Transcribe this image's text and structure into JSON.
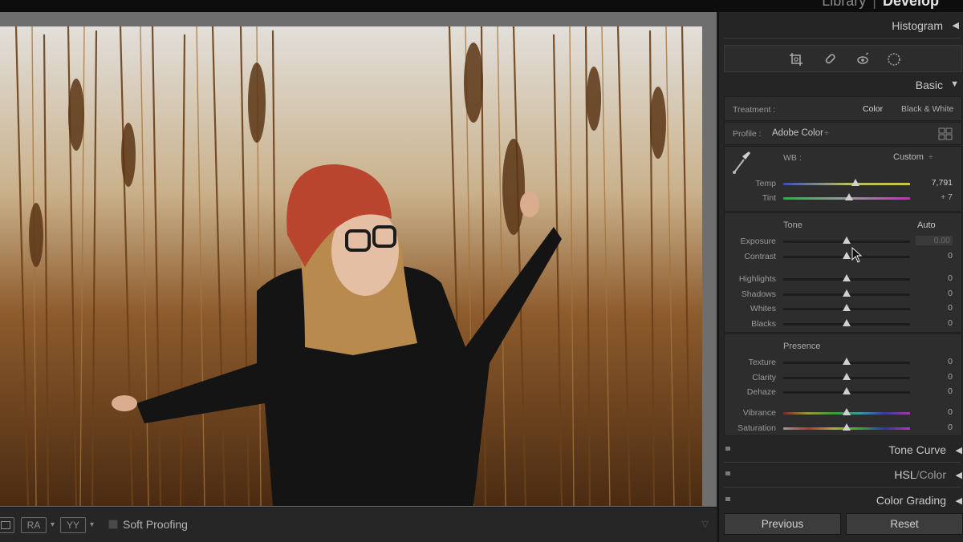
{
  "module_picker": {
    "library": "Library",
    "separator": "|",
    "develop": "Develop"
  },
  "panels": {
    "histogram": "Histogram",
    "basic": "Basic",
    "tone_curve": "Tone Curve",
    "hsl": "HSL",
    "hsl_sep": "/",
    "color": "Color",
    "color_grading": "Color Grading"
  },
  "tools": [
    "crop-overlay-icon",
    "healing-icon",
    "red-eye-icon",
    "masking-icon"
  ],
  "basic": {
    "treatment_label": "Treatment :",
    "treatment_color": "Color",
    "treatment_bw": "Black & White",
    "profile_label": "Profile :",
    "profile_value": "Adobe Color",
    "profile_stepper": "÷",
    "wb_label": "WB :",
    "wb_value": "Custom",
    "wb_stepper": "÷",
    "temp": {
      "label": "Temp",
      "value": "7,791",
      "level": 0.57
    },
    "tint": {
      "label": "Tint",
      "value": "+ 7",
      "level": 0.52
    },
    "tone_label": "Tone",
    "auto_label": "Auto",
    "tone": [
      {
        "label": "Exposure",
        "value": "0.00",
        "level": 0.5
      },
      {
        "label": "Contrast",
        "value": "0",
        "level": 0.5
      }
    ],
    "tone2": [
      {
        "label": "Highlights",
        "value": "0",
        "level": 0.5
      },
      {
        "label": "Shadows",
        "value": "0",
        "level": 0.5
      },
      {
        "label": "Whites",
        "value": "0",
        "level": 0.5
      },
      {
        "label": "Blacks",
        "value": "0",
        "level": 0.5
      }
    ],
    "presence_label": "Presence",
    "presence": [
      {
        "label": "Texture",
        "value": "0",
        "level": 0.5
      },
      {
        "label": "Clarity",
        "value": "0",
        "level": 0.5
      },
      {
        "label": "Dehaze",
        "value": "0",
        "level": 0.5
      }
    ],
    "color_sliders": [
      {
        "label": "Vibrance",
        "value": "0",
        "level": 0.5
      },
      {
        "label": "Saturation",
        "value": "0",
        "level": 0.5
      }
    ]
  },
  "toolbar": {
    "view_compare_label": "RA",
    "view_survey_label": "YY",
    "soft_proofing": "Soft Proofing"
  },
  "buttons": {
    "previous": "Previous",
    "reset": "Reset"
  },
  "colors": {
    "accent_panel": "#252525",
    "photo_tone": "#8a5a2c"
  }
}
